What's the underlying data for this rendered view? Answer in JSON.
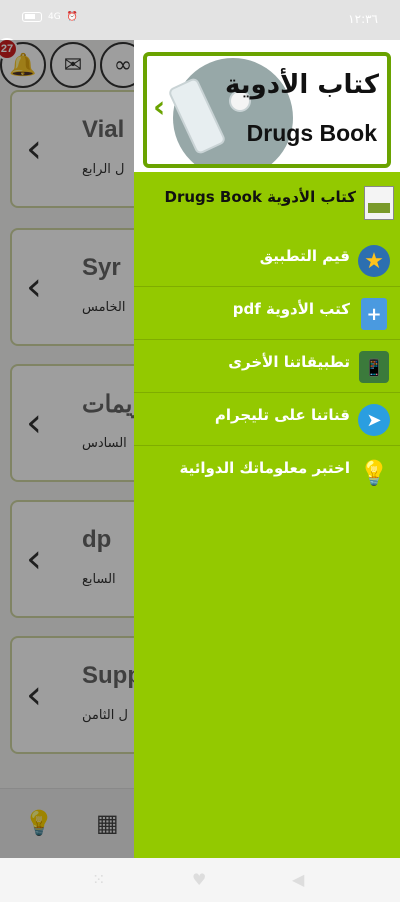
{
  "status_bar": {
    "time": "١٢:٣٦",
    "signal_text": "4G"
  },
  "background": {
    "notification_count": "27",
    "cards": [
      {
        "title": "Vial",
        "subtitle": "ل الرابع"
      },
      {
        "title": "Syr",
        "subtitle": "الخامس"
      },
      {
        "title": "ريمات",
        "subtitle": "السادس"
      },
      {
        "title": "dp",
        "subtitle": "السابع"
      },
      {
        "title": "Supp",
        "subtitle": "ل الثامن"
      }
    ]
  },
  "drawer": {
    "banner": {
      "title_ar": "كتاب الأدوية",
      "title_en": "Drugs Book"
    },
    "app_name": "كتاب الأدوية Drugs Book",
    "items": [
      {
        "label": "قيم التطبيق",
        "icon": "star-icon"
      },
      {
        "label": "كتب الأدوية pdf",
        "icon": "book-icon"
      },
      {
        "label": "تطبيقاتنا الأخرى",
        "icon": "phone-icon"
      },
      {
        "label": "قناتنا على تليجرام",
        "icon": "telegram-icon"
      },
      {
        "label": "اختبر معلوماتك الدوائية",
        "icon": "lightbulb-icon"
      }
    ]
  },
  "colors": {
    "drawer_bg": "#93c900",
    "accent": "#6aa300"
  }
}
